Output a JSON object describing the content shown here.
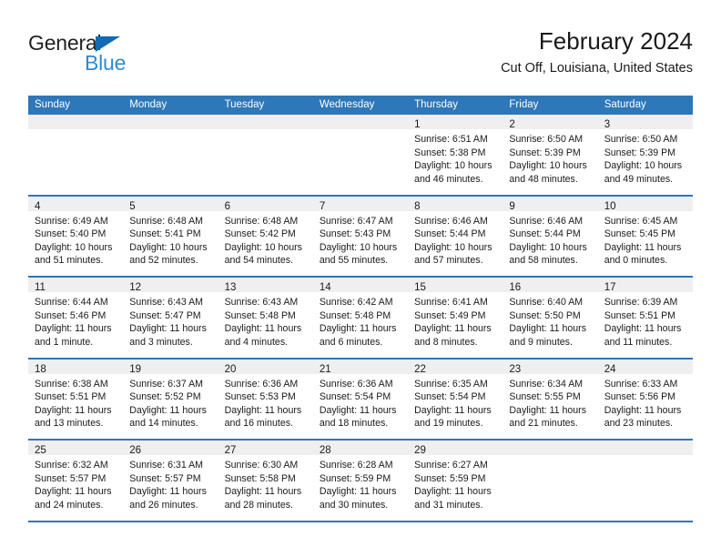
{
  "brand": {
    "name_part1": "General",
    "name_part2": "Blue",
    "triangle_color": "#0f6cb5",
    "blue_color": "#2e8bd0",
    "dark_color": "#231f20"
  },
  "header": {
    "title": "February 2024",
    "subtitle": "Cut Off, Louisiana, United States"
  },
  "theme": {
    "header_bg": "#2e77b8",
    "header_text": "#ffffff",
    "day_band_bg": "#efefef",
    "cell_bg": "#ffffff",
    "row_divider": "#2e77b8"
  },
  "weekdays": [
    "Sunday",
    "Monday",
    "Tuesday",
    "Wednesday",
    "Thursday",
    "Friday",
    "Saturday"
  ],
  "weeks": [
    [
      {
        "day": "",
        "empty": true,
        "sunrise": "",
        "sunset": "",
        "daylight1": "",
        "daylight2": ""
      },
      {
        "day": "",
        "empty": true,
        "sunrise": "",
        "sunset": "",
        "daylight1": "",
        "daylight2": ""
      },
      {
        "day": "",
        "empty": true,
        "sunrise": "",
        "sunset": "",
        "daylight1": "",
        "daylight2": ""
      },
      {
        "day": "",
        "empty": true,
        "sunrise": "",
        "sunset": "",
        "daylight1": "",
        "daylight2": ""
      },
      {
        "day": "1",
        "empty": false,
        "sunrise": "Sunrise: 6:51 AM",
        "sunset": "Sunset: 5:38 PM",
        "daylight1": "Daylight: 10 hours",
        "daylight2": "and 46 minutes."
      },
      {
        "day": "2",
        "empty": false,
        "sunrise": "Sunrise: 6:50 AM",
        "sunset": "Sunset: 5:39 PM",
        "daylight1": "Daylight: 10 hours",
        "daylight2": "and 48 minutes."
      },
      {
        "day": "3",
        "empty": false,
        "sunrise": "Sunrise: 6:50 AM",
        "sunset": "Sunset: 5:39 PM",
        "daylight1": "Daylight: 10 hours",
        "daylight2": "and 49 minutes."
      }
    ],
    [
      {
        "day": "4",
        "empty": false,
        "sunrise": "Sunrise: 6:49 AM",
        "sunset": "Sunset: 5:40 PM",
        "daylight1": "Daylight: 10 hours",
        "daylight2": "and 51 minutes."
      },
      {
        "day": "5",
        "empty": false,
        "sunrise": "Sunrise: 6:48 AM",
        "sunset": "Sunset: 5:41 PM",
        "daylight1": "Daylight: 10 hours",
        "daylight2": "and 52 minutes."
      },
      {
        "day": "6",
        "empty": false,
        "sunrise": "Sunrise: 6:48 AM",
        "sunset": "Sunset: 5:42 PM",
        "daylight1": "Daylight: 10 hours",
        "daylight2": "and 54 minutes."
      },
      {
        "day": "7",
        "empty": false,
        "sunrise": "Sunrise: 6:47 AM",
        "sunset": "Sunset: 5:43 PM",
        "daylight1": "Daylight: 10 hours",
        "daylight2": "and 55 minutes."
      },
      {
        "day": "8",
        "empty": false,
        "sunrise": "Sunrise: 6:46 AM",
        "sunset": "Sunset: 5:44 PM",
        "daylight1": "Daylight: 10 hours",
        "daylight2": "and 57 minutes."
      },
      {
        "day": "9",
        "empty": false,
        "sunrise": "Sunrise: 6:46 AM",
        "sunset": "Sunset: 5:44 PM",
        "daylight1": "Daylight: 10 hours",
        "daylight2": "and 58 minutes."
      },
      {
        "day": "10",
        "empty": false,
        "sunrise": "Sunrise: 6:45 AM",
        "sunset": "Sunset: 5:45 PM",
        "daylight1": "Daylight: 11 hours",
        "daylight2": "and 0 minutes."
      }
    ],
    [
      {
        "day": "11",
        "empty": false,
        "sunrise": "Sunrise: 6:44 AM",
        "sunset": "Sunset: 5:46 PM",
        "daylight1": "Daylight: 11 hours",
        "daylight2": "and 1 minute."
      },
      {
        "day": "12",
        "empty": false,
        "sunrise": "Sunrise: 6:43 AM",
        "sunset": "Sunset: 5:47 PM",
        "daylight1": "Daylight: 11 hours",
        "daylight2": "and 3 minutes."
      },
      {
        "day": "13",
        "empty": false,
        "sunrise": "Sunrise: 6:43 AM",
        "sunset": "Sunset: 5:48 PM",
        "daylight1": "Daylight: 11 hours",
        "daylight2": "and 4 minutes."
      },
      {
        "day": "14",
        "empty": false,
        "sunrise": "Sunrise: 6:42 AM",
        "sunset": "Sunset: 5:48 PM",
        "daylight1": "Daylight: 11 hours",
        "daylight2": "and 6 minutes."
      },
      {
        "day": "15",
        "empty": false,
        "sunrise": "Sunrise: 6:41 AM",
        "sunset": "Sunset: 5:49 PM",
        "daylight1": "Daylight: 11 hours",
        "daylight2": "and 8 minutes."
      },
      {
        "day": "16",
        "empty": false,
        "sunrise": "Sunrise: 6:40 AM",
        "sunset": "Sunset: 5:50 PM",
        "daylight1": "Daylight: 11 hours",
        "daylight2": "and 9 minutes."
      },
      {
        "day": "17",
        "empty": false,
        "sunrise": "Sunrise: 6:39 AM",
        "sunset": "Sunset: 5:51 PM",
        "daylight1": "Daylight: 11 hours",
        "daylight2": "and 11 minutes."
      }
    ],
    [
      {
        "day": "18",
        "empty": false,
        "sunrise": "Sunrise: 6:38 AM",
        "sunset": "Sunset: 5:51 PM",
        "daylight1": "Daylight: 11 hours",
        "daylight2": "and 13 minutes."
      },
      {
        "day": "19",
        "empty": false,
        "sunrise": "Sunrise: 6:37 AM",
        "sunset": "Sunset: 5:52 PM",
        "daylight1": "Daylight: 11 hours",
        "daylight2": "and 14 minutes."
      },
      {
        "day": "20",
        "empty": false,
        "sunrise": "Sunrise: 6:36 AM",
        "sunset": "Sunset: 5:53 PM",
        "daylight1": "Daylight: 11 hours",
        "daylight2": "and 16 minutes."
      },
      {
        "day": "21",
        "empty": false,
        "sunrise": "Sunrise: 6:36 AM",
        "sunset": "Sunset: 5:54 PM",
        "daylight1": "Daylight: 11 hours",
        "daylight2": "and 18 minutes."
      },
      {
        "day": "22",
        "empty": false,
        "sunrise": "Sunrise: 6:35 AM",
        "sunset": "Sunset: 5:54 PM",
        "daylight1": "Daylight: 11 hours",
        "daylight2": "and 19 minutes."
      },
      {
        "day": "23",
        "empty": false,
        "sunrise": "Sunrise: 6:34 AM",
        "sunset": "Sunset: 5:55 PM",
        "daylight1": "Daylight: 11 hours",
        "daylight2": "and 21 minutes."
      },
      {
        "day": "24",
        "empty": false,
        "sunrise": "Sunrise: 6:33 AM",
        "sunset": "Sunset: 5:56 PM",
        "daylight1": "Daylight: 11 hours",
        "daylight2": "and 23 minutes."
      }
    ],
    [
      {
        "day": "25",
        "empty": false,
        "sunrise": "Sunrise: 6:32 AM",
        "sunset": "Sunset: 5:57 PM",
        "daylight1": "Daylight: 11 hours",
        "daylight2": "and 24 minutes."
      },
      {
        "day": "26",
        "empty": false,
        "sunrise": "Sunrise: 6:31 AM",
        "sunset": "Sunset: 5:57 PM",
        "daylight1": "Daylight: 11 hours",
        "daylight2": "and 26 minutes."
      },
      {
        "day": "27",
        "empty": false,
        "sunrise": "Sunrise: 6:30 AM",
        "sunset": "Sunset: 5:58 PM",
        "daylight1": "Daylight: 11 hours",
        "daylight2": "and 28 minutes."
      },
      {
        "day": "28",
        "empty": false,
        "sunrise": "Sunrise: 6:28 AM",
        "sunset": "Sunset: 5:59 PM",
        "daylight1": "Daylight: 11 hours",
        "daylight2": "and 30 minutes."
      },
      {
        "day": "29",
        "empty": false,
        "sunrise": "Sunrise: 6:27 AM",
        "sunset": "Sunset: 5:59 PM",
        "daylight1": "Daylight: 11 hours",
        "daylight2": "and 31 minutes."
      },
      {
        "day": "",
        "empty": true,
        "sunrise": "",
        "sunset": "",
        "daylight1": "",
        "daylight2": ""
      },
      {
        "day": "",
        "empty": true,
        "sunrise": "",
        "sunset": "",
        "daylight1": "",
        "daylight2": ""
      }
    ]
  ]
}
